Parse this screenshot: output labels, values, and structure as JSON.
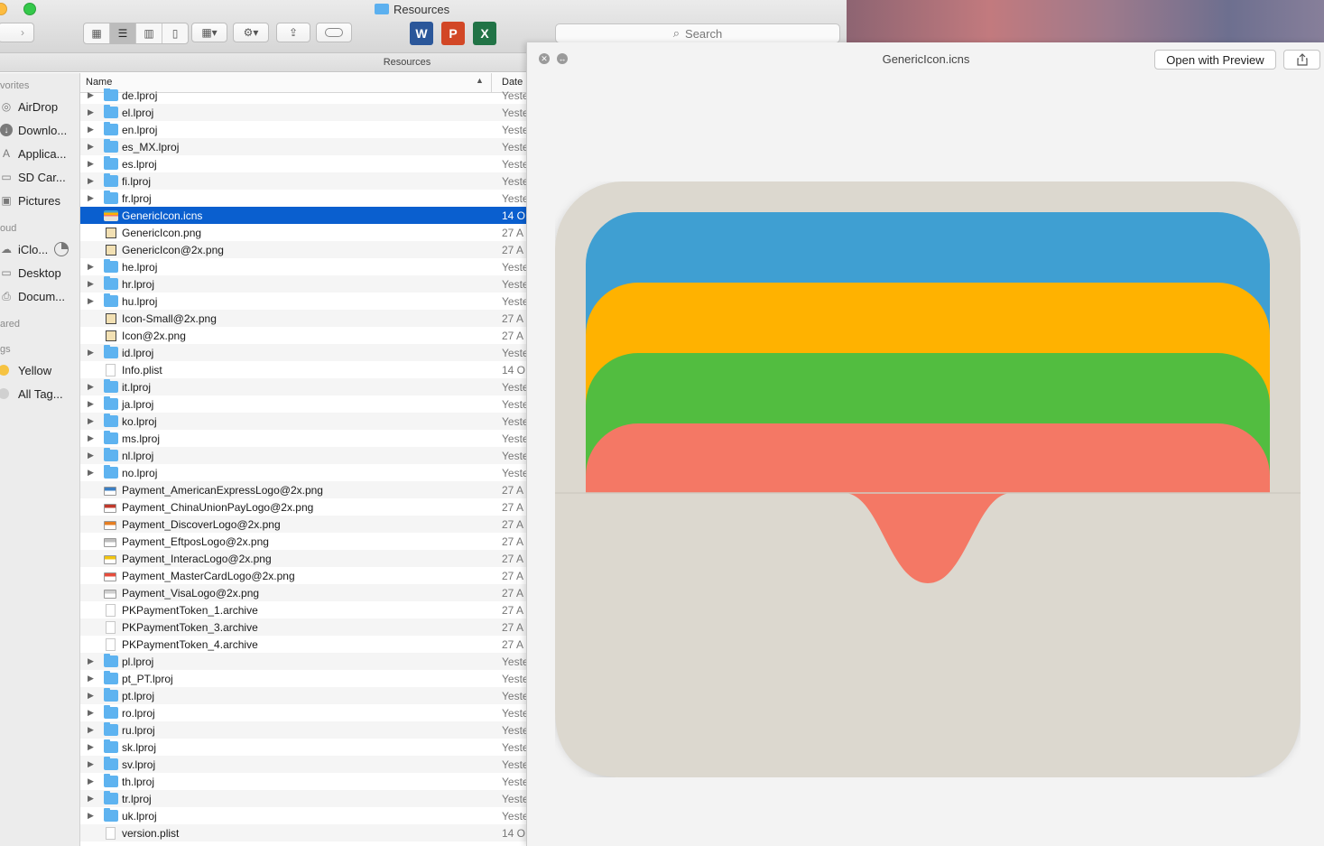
{
  "finder": {
    "title": "Resources",
    "path_title": "Resources",
    "search_placeholder": "Search",
    "column_name": "Name",
    "column_date": "Date",
    "sidebar": {
      "favorites_header": "vorites",
      "favorites": [
        "AirDrop",
        "Downlo...",
        "Applica...",
        "SD Car...",
        "Pictures"
      ],
      "icloud_header": "oud",
      "icloud": [
        "iClo...",
        "Desktop",
        "Docum..."
      ],
      "shared_header": "ared",
      "tags_header": "gs",
      "tags": [
        "Yellow",
        "All Tag..."
      ],
      "tag_color": "#f6c342"
    },
    "files": [
      {
        "name": "de.lproj",
        "date": "Yeste",
        "type": "folder"
      },
      {
        "name": "el.lproj",
        "date": "Yeste",
        "type": "folder"
      },
      {
        "name": "en.lproj",
        "date": "Yeste",
        "type": "folder"
      },
      {
        "name": "es_MX.lproj",
        "date": "Yeste",
        "type": "folder"
      },
      {
        "name": "es.lproj",
        "date": "Yeste",
        "type": "folder"
      },
      {
        "name": "fi.lproj",
        "date": "Yeste",
        "type": "folder"
      },
      {
        "name": "fr.lproj",
        "date": "Yeste",
        "type": "folder"
      },
      {
        "name": "GenericIcon.icns",
        "date": "14 O",
        "type": "icns",
        "selected": true
      },
      {
        "name": "GenericIcon.png",
        "date": "27 A",
        "type": "png"
      },
      {
        "name": "GenericIcon@2x.png",
        "date": "27 A",
        "type": "png"
      },
      {
        "name": "he.lproj",
        "date": "Yeste",
        "type": "folder"
      },
      {
        "name": "hr.lproj",
        "date": "Yeste",
        "type": "folder"
      },
      {
        "name": "hu.lproj",
        "date": "Yeste",
        "type": "folder"
      },
      {
        "name": "Icon-Small@2x.png",
        "date": "27 A",
        "type": "png"
      },
      {
        "name": "Icon@2x.png",
        "date": "27 A",
        "type": "png"
      },
      {
        "name": "id.lproj",
        "date": "Yeste",
        "type": "folder"
      },
      {
        "name": "Info.plist",
        "date": "14 O",
        "type": "doc"
      },
      {
        "name": "it.lproj",
        "date": "Yeste",
        "type": "folder"
      },
      {
        "name": "ja.lproj",
        "date": "Yeste",
        "type": "folder"
      },
      {
        "name": "ko.lproj",
        "date": "Yeste",
        "type": "folder"
      },
      {
        "name": "ms.lproj",
        "date": "Yeste",
        "type": "folder"
      },
      {
        "name": "nl.lproj",
        "date": "Yeste",
        "type": "folder"
      },
      {
        "name": "no.lproj",
        "date": "Yeste",
        "type": "folder"
      },
      {
        "name": "Payment_AmericanExpressLogo@2x.png",
        "date": "27 A",
        "type": "card",
        "color": "#3b7fc4"
      },
      {
        "name": "Payment_ChinaUnionPayLogo@2x.png",
        "date": "27 A",
        "type": "card",
        "color": "#c0392b"
      },
      {
        "name": "Payment_DiscoverLogo@2x.png",
        "date": "27 A",
        "type": "card",
        "color": "#e67e22"
      },
      {
        "name": "Payment_EftposLogo@2x.png",
        "date": "27 A",
        "type": "card",
        "color": "#bdbdbd"
      },
      {
        "name": "Payment_InteracLogo@2x.png",
        "date": "27 A",
        "type": "card",
        "color": "#f1c40f"
      },
      {
        "name": "Payment_MasterCardLogo@2x.png",
        "date": "27 A",
        "type": "card",
        "color": "#e74c3c"
      },
      {
        "name": "Payment_VisaLogo@2x.png",
        "date": "27 A",
        "type": "card",
        "color": "#cfcfcf"
      },
      {
        "name": "PKPaymentToken_1.archive",
        "date": "27 A",
        "type": "doc"
      },
      {
        "name": "PKPaymentToken_3.archive",
        "date": "27 A",
        "type": "doc"
      },
      {
        "name": "PKPaymentToken_4.archive",
        "date": "27 A",
        "type": "doc"
      },
      {
        "name": "pl.lproj",
        "date": "Yeste",
        "type": "folder"
      },
      {
        "name": "pt_PT.lproj",
        "date": "Yeste",
        "type": "folder"
      },
      {
        "name": "pt.lproj",
        "date": "Yeste",
        "type": "folder"
      },
      {
        "name": "ro.lproj",
        "date": "Yeste",
        "type": "folder"
      },
      {
        "name": "ru.lproj",
        "date": "Yeste",
        "type": "folder"
      },
      {
        "name": "sk.lproj",
        "date": "Yeste",
        "type": "folder"
      },
      {
        "name": "sv.lproj",
        "date": "Yeste",
        "type": "folder"
      },
      {
        "name": "th.lproj",
        "date": "Yeste",
        "type": "folder"
      },
      {
        "name": "tr.lproj",
        "date": "Yeste",
        "type": "folder"
      },
      {
        "name": "uk.lproj",
        "date": "Yeste",
        "type": "folder"
      },
      {
        "name": "version.plist",
        "date": "14 O",
        "type": "doc"
      }
    ]
  },
  "toolbar": {
    "apps": [
      {
        "letter": "W",
        "color": "#2b579a",
        "icon": "word-icon"
      },
      {
        "letter": "P",
        "color": "#d24726",
        "icon": "powerpoint-icon"
      },
      {
        "letter": "X",
        "color": "#217346",
        "icon": "excel-icon"
      }
    ]
  },
  "quicklook": {
    "title": "GenericIcon.icns",
    "open_button": "Open with Preview",
    "wallet_colors": {
      "blue": "#3f9fd2",
      "yellow": "#ffb200",
      "green": "#52bd40",
      "red": "#f47865",
      "pocket": "#dcd8cf"
    }
  },
  "colors": {
    "selection": "#0a5fcf",
    "folder": "#5eb3f0"
  }
}
